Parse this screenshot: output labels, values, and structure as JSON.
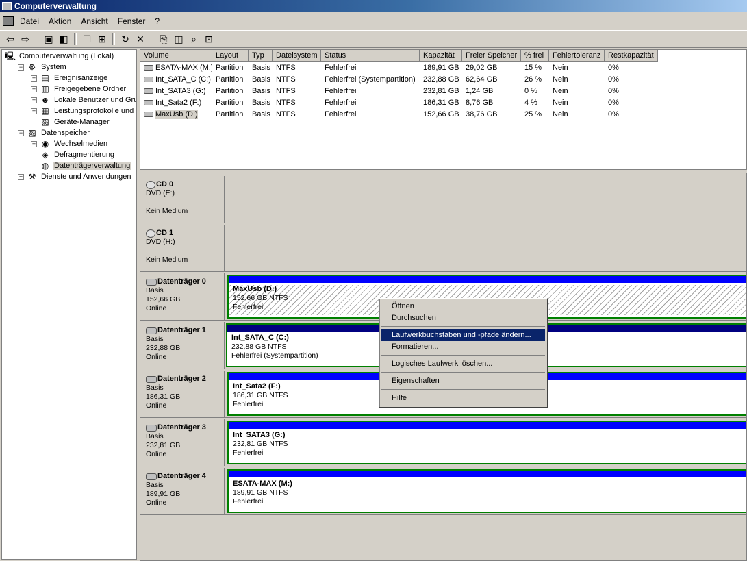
{
  "window": {
    "title": "Computerverwaltung"
  },
  "menu": [
    "Datei",
    "Aktion",
    "Ansicht",
    "Fenster",
    "?"
  ],
  "toolbar": {
    "buttons": [
      "back-icon",
      "forward-icon",
      "sep",
      "up-folder-icon",
      "show-tree-icon",
      "sep",
      "properties-icon",
      "export-icon",
      "sep",
      "refresh-icon",
      "delete-icon",
      "sep",
      "connect-icon",
      "open-icon",
      "find-icon",
      "help-icon"
    ]
  },
  "tree": [
    {
      "label": "Computerverwaltung (Lokal)",
      "level": 0,
      "exp": "",
      "icon": "computer-icon"
    },
    {
      "label": "System",
      "level": 1,
      "exp": "−",
      "icon": "system-icon"
    },
    {
      "label": "Ereignisanzeige",
      "level": 2,
      "exp": "+",
      "icon": "event-viewer-icon"
    },
    {
      "label": "Freigegebene Ordner",
      "level": 2,
      "exp": "+",
      "icon": "shared-folder-icon"
    },
    {
      "label": "Lokale Benutzer und Gruppen",
      "level": 2,
      "exp": "+",
      "icon": "users-icon"
    },
    {
      "label": "Leistungsprotokolle und Warnungen",
      "level": 2,
      "exp": "+",
      "icon": "performance-icon"
    },
    {
      "label": "Geräte-Manager",
      "level": 2,
      "exp": "",
      "icon": "device-manager-icon"
    },
    {
      "label": "Datenspeicher",
      "level": 1,
      "exp": "−",
      "icon": "storage-icon"
    },
    {
      "label": "Wechselmedien",
      "level": 2,
      "exp": "+",
      "icon": "removable-media-icon"
    },
    {
      "label": "Defragmentierung",
      "level": 2,
      "exp": "",
      "icon": "defrag-icon"
    },
    {
      "label": "Datenträgerverwaltung",
      "level": 2,
      "exp": "",
      "icon": "disk-management-icon",
      "selected": true
    },
    {
      "label": "Dienste und Anwendungen",
      "level": 1,
      "exp": "+",
      "icon": "services-icon"
    }
  ],
  "columns": [
    "Volume",
    "Layout",
    "Typ",
    "Dateisystem",
    "Status",
    "Kapazität",
    "Freier Speicher",
    "% frei",
    "Fehlertoleranz",
    "Restkapazität"
  ],
  "volumes": [
    [
      "ESATA-MAX (M:)",
      "Partition",
      "Basis",
      "NTFS",
      "Fehlerfrei",
      "189,91 GB",
      "29,02 GB",
      "15 %",
      "Nein",
      "0%"
    ],
    [
      "Int_SATA_C (C:)",
      "Partition",
      "Basis",
      "NTFS",
      "Fehlerfrei (Systempartition)",
      "232,88 GB",
      "62,64 GB",
      "26 %",
      "Nein",
      "0%"
    ],
    [
      "Int_SATA3 (G:)",
      "Partition",
      "Basis",
      "NTFS",
      "Fehlerfrei",
      "232,81 GB",
      "1,24 GB",
      "0 %",
      "Nein",
      "0%"
    ],
    [
      "Int_Sata2 (F:)",
      "Partition",
      "Basis",
      "NTFS",
      "Fehlerfrei",
      "186,31 GB",
      "8,76 GB",
      "4 %",
      "Nein",
      "0%"
    ],
    [
      "MaxUsb (D:)",
      "Partition",
      "Basis",
      "NTFS",
      "Fehlerfrei",
      "152,66 GB",
      "38,76 GB",
      "25 %",
      "Nein",
      "0%"
    ]
  ],
  "disks": [
    {
      "name": "CD 0",
      "kind": "cd",
      "lines": [
        "DVD (E:)",
        "",
        "Kein Medium"
      ],
      "partition": null
    },
    {
      "name": "CD 1",
      "kind": "cd",
      "lines": [
        "DVD (H:)",
        "",
        "Kein Medium"
      ],
      "partition": null
    },
    {
      "name": "Datenträger 0",
      "kind": "disk",
      "lines": [
        "Basis",
        "152,66 GB",
        "Online"
      ],
      "partition": {
        "name": "MaxUsb  (D:)",
        "size": "152,66 GB NTFS",
        "status": "Fehlerfrei",
        "selected": true
      }
    },
    {
      "name": "Datenträger 1",
      "kind": "disk",
      "lines": [
        "Basis",
        "232,88 GB",
        "Online"
      ],
      "partition": {
        "name": "Int_SATA_C  (C:)",
        "size": "232,88 GB NTFS",
        "status": "Fehlerfrei (Systempartition)",
        "dark": true
      }
    },
    {
      "name": "Datenträger 2",
      "kind": "disk",
      "lines": [
        "Basis",
        "186,31 GB",
        "Online"
      ],
      "partition": {
        "name": "Int_Sata2  (F:)",
        "size": "186,31 GB NTFS",
        "status": "Fehlerfrei"
      }
    },
    {
      "name": "Datenträger 3",
      "kind": "disk",
      "lines": [
        "Basis",
        "232,81 GB",
        "Online"
      ],
      "partition": {
        "name": "Int_SATA3  (G:)",
        "size": "232,81 GB NTFS",
        "status": "Fehlerfrei"
      }
    },
    {
      "name": "Datenträger 4",
      "kind": "disk",
      "lines": [
        "Basis",
        "189,91 GB",
        "Online"
      ],
      "partition": {
        "name": "ESATA-MAX  (M:)",
        "size": "189,91 GB NTFS",
        "status": "Fehlerfrei"
      }
    }
  ],
  "context_menu": [
    {
      "label": "Öffnen"
    },
    {
      "label": "Durchsuchen"
    },
    {
      "sep": true
    },
    {
      "label": "Laufwerkbuchstaben und -pfade ändern...",
      "highlight": true
    },
    {
      "label": "Formatieren..."
    },
    {
      "sep": true
    },
    {
      "label": "Logisches Laufwerk löschen..."
    },
    {
      "sep": true
    },
    {
      "label": "Eigenschaften"
    },
    {
      "sep": true
    },
    {
      "label": "Hilfe"
    }
  ]
}
